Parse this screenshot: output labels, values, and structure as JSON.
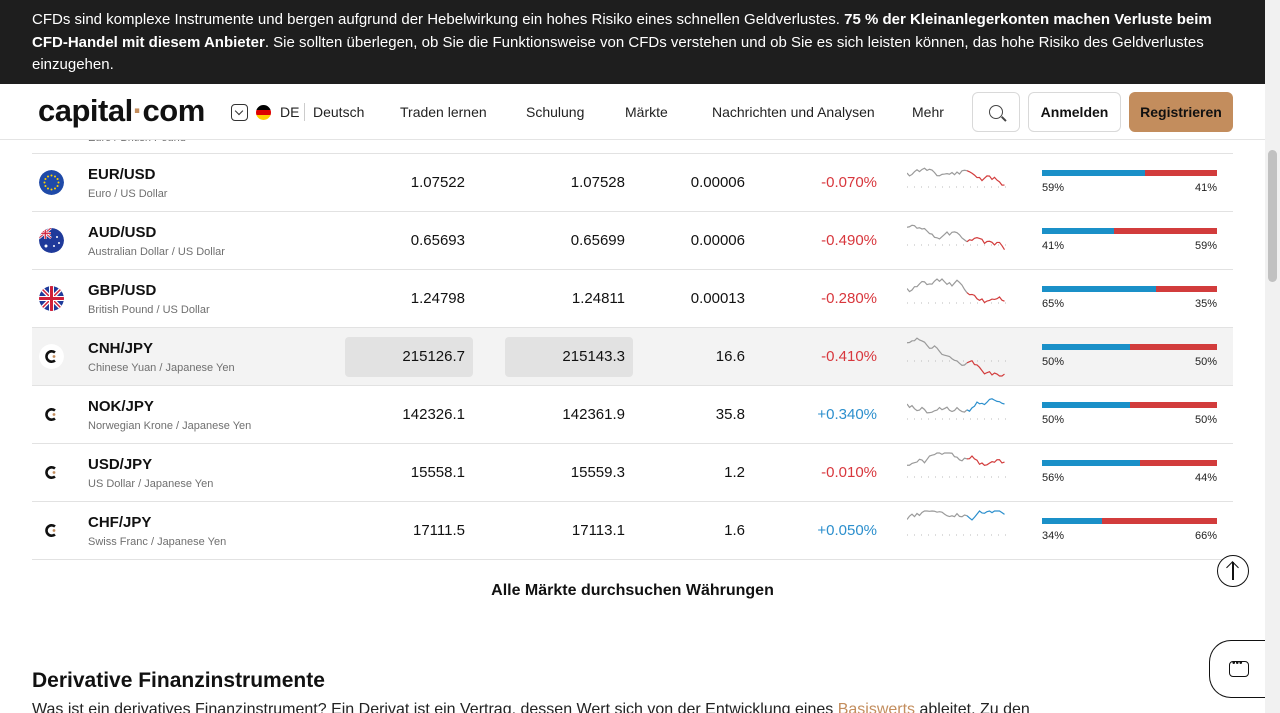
{
  "risk_banner": {
    "text_1": "CFDs sind komplexe Instrumente und bergen aufgrund der Hebelwirkung ein hohes Risiko eines schnellen Geldverlustes. ",
    "text_bold": "75 % der Kleinanlegerkonten machen Verluste beim CFD-Handel mit diesem Anbieter",
    "text_2": ". Sie sollten überlegen, ob Sie die Funktionsweise von CFDs verstehen und ob Sie es sich leisten können, das hohe Risiko des Geldverlustes einzugehen."
  },
  "header": {
    "logo_left": "capital",
    "logo_dot": "·",
    "logo_right": "com",
    "lang_code": "DE",
    "lang_name": "Deutsch",
    "nav": [
      "Traden lernen",
      "Schulung",
      "Märkte",
      "Nachrichten und Analysen",
      "Mehr"
    ],
    "login": "Anmelden",
    "register": "Registrieren"
  },
  "rows": [
    {
      "pair": "EUR/USD",
      "desc": "Euro / US Dollar",
      "sell": "1.07522",
      "buy": "1.07528",
      "spread": "0.00006",
      "change": "-0.070%",
      "dir": "neg",
      "buy_pct": 59,
      "left": "59%",
      "right": "41%",
      "icon": "eu-flag-icon"
    },
    {
      "pair": "AUD/USD",
      "desc": "Australian Dollar / US Dollar",
      "sell": "0.65693",
      "buy": "0.65699",
      "spread": "0.00006",
      "change": "-0.490%",
      "dir": "neg",
      "buy_pct": 41,
      "left": "41%",
      "right": "59%",
      "icon": "au-flag-icon"
    },
    {
      "pair": "GBP/USD",
      "desc": "British Pound / US Dollar",
      "sell": "1.24798",
      "buy": "1.24811",
      "spread": "0.00013",
      "change": "-0.280%",
      "dir": "neg",
      "buy_pct": 65,
      "left": "65%",
      "right": "35%",
      "icon": "uk-flag-icon"
    },
    {
      "pair": "CNH/JPY",
      "desc": "Chinese Yuan / Japanese Yen",
      "sell": "215126.7",
      "buy": "215143.3",
      "spread": "16.6",
      "change": "-0.410%",
      "dir": "neg",
      "buy_pct": 50,
      "left": "50%",
      "right": "50%",
      "icon": "capital-logo-icon"
    },
    {
      "pair": "NOK/JPY",
      "desc": "Norwegian Krone / Japanese Yen",
      "sell": "142326.1",
      "buy": "142361.9",
      "spread": "35.8",
      "change": "+0.340%",
      "dir": "pos",
      "buy_pct": 50,
      "left": "50%",
      "right": "50%",
      "icon": "capital-logo-icon"
    },
    {
      "pair": "USD/JPY",
      "desc": "US Dollar / Japanese Yen",
      "sell": "15558.1",
      "buy": "15559.3",
      "spread": "1.2",
      "change": "-0.010%",
      "dir": "neg",
      "buy_pct": 56,
      "left": "56%",
      "right": "44%",
      "icon": "capital-logo-icon"
    },
    {
      "pair": "CHF/JPY",
      "desc": "Swiss Franc / Japanese Yen",
      "sell": "17111.5",
      "buy": "17113.1",
      "spread": "1.6",
      "change": "+0.050%",
      "dir": "pos",
      "buy_pct": 34,
      "left": "34%",
      "right": "66%",
      "icon": "capital-logo-icon"
    }
  ],
  "partial_row_desc": "Euro / British Pound",
  "all_markets": "Alle Märkte durchsuchen Währungen",
  "section": {
    "title": "Derivative Finanzinstrumente",
    "body_1": "Was ist ein derivatives Finanzinstrument? Ein Derivat ist ein Vertrag, dessen Wert sich von der Entwicklung eines ",
    "body_link": "Basiswerts",
    "body_2": " ableitet. Zu den"
  },
  "colors": {
    "accent": "#c38d5d",
    "buy": "#1a90c8",
    "sell": "#d23c3c",
    "negative": "#d8373d",
    "positive": "#2c8fcd"
  }
}
